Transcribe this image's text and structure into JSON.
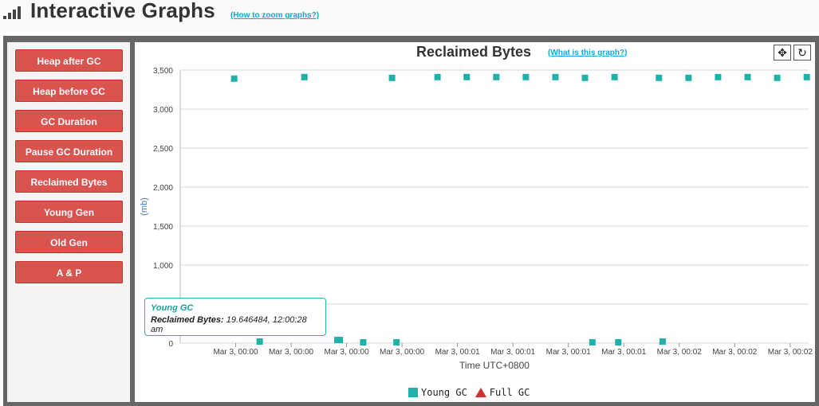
{
  "header": {
    "title": "Interactive Graphs",
    "zoom_link": "(How to zoom graphs?)"
  },
  "sidebar": {
    "items": [
      {
        "label": "Heap after GC"
      },
      {
        "label": "Heap before GC"
      },
      {
        "label": "GC Duration"
      },
      {
        "label": "Pause GC Duration"
      },
      {
        "label": "Reclaimed Bytes"
      },
      {
        "label": "Young Gen"
      },
      {
        "label": "Old Gen"
      },
      {
        "label": "A & P"
      }
    ]
  },
  "toolbar": {
    "pan_icon": "move-arrows-icon",
    "reset_icon": "refresh-icon"
  },
  "tooltip": {
    "series": "Young GC",
    "label": "Reclaimed Bytes:",
    "value": "19.646484, 12:00:28 am"
  },
  "colors": {
    "young": "#20b2aa",
    "full": "#cc3333",
    "button": "#d9534f"
  },
  "chart_data": {
    "type": "scatter",
    "title": "Reclaimed Bytes",
    "help_link": "(What is this graph?)",
    "ylabel": "(mb)",
    "xlabel": "Time UTC+0800",
    "ylim": [
      0,
      3500
    ],
    "ytick_labels": [
      "0",
      "500",
      "1,000",
      "1,500",
      "2,000",
      "2,500",
      "3,000",
      "3,500"
    ],
    "yticks": [
      0,
      500,
      1000,
      1500,
      2000,
      2500,
      3000,
      3500
    ],
    "xtick_labels": [
      "Mar 3, 00:00",
      "Mar 3, 00:00",
      "Mar 3, 00:00",
      "Mar 3, 00:00",
      "Mar 3, 00:01",
      "Mar 3, 00:01",
      "Mar 3, 00:01",
      "Mar 3, 00:01",
      "Mar 3, 00:02",
      "Mar 3, 00:02",
      "Mar 3, 00:02"
    ],
    "xtick_seconds": [
      35,
      50,
      65,
      80,
      95,
      110,
      125,
      140,
      155,
      170,
      185
    ],
    "xlim_seconds": [
      20,
      190
    ],
    "grid": true,
    "legend_position": "bottom",
    "series": [
      {
        "name": "Young GC",
        "marker": "square",
        "time_seconds": [
          34.6,
          41.5,
          53.6,
          62.5,
          63.2,
          69.5,
          77.3,
          78.5,
          89.6,
          97.5,
          105.5,
          113.5,
          121.5,
          129.5,
          131.5,
          137.5,
          138.5,
          149.5,
          150.5,
          157.5,
          165.5,
          173.5,
          181.5,
          189.5
        ],
        "values": [
          3390,
          20,
          3410,
          40,
          40,
          10,
          3400,
          10,
          3410,
          3410,
          3410,
          3410,
          3410,
          3400,
          10,
          3410,
          10,
          3400,
          20,
          3400,
          3410,
          3410,
          3400,
          3410
        ]
      },
      {
        "name": "Full GC",
        "marker": "triangle",
        "time_seconds": [],
        "values": []
      }
    ]
  }
}
